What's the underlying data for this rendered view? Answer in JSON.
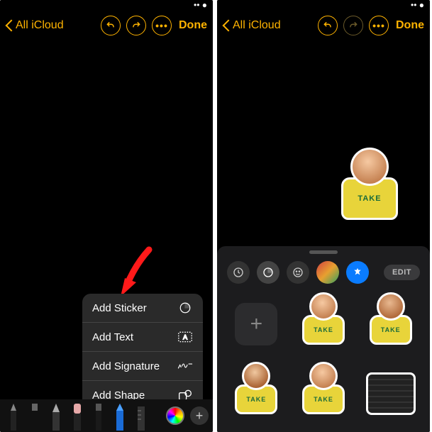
{
  "nav": {
    "back_label": "All iCloud",
    "done_label": "Done"
  },
  "menu": {
    "items": [
      {
        "label": "Add Sticker",
        "icon": "sticker-peel-icon"
      },
      {
        "label": "Add Text",
        "icon": "text-box-icon"
      },
      {
        "label": "Add Signature",
        "icon": "signature-icon"
      },
      {
        "label": "Add Shape",
        "icon": "shapes-icon"
      }
    ]
  },
  "tools": {
    "items": [
      "pen",
      "marker",
      "pencil",
      "eraser",
      "lasso",
      "crayon-blue",
      "ruler"
    ]
  },
  "drawer": {
    "edit_label": "EDIT"
  },
  "sticker_text": "TAKE"
}
